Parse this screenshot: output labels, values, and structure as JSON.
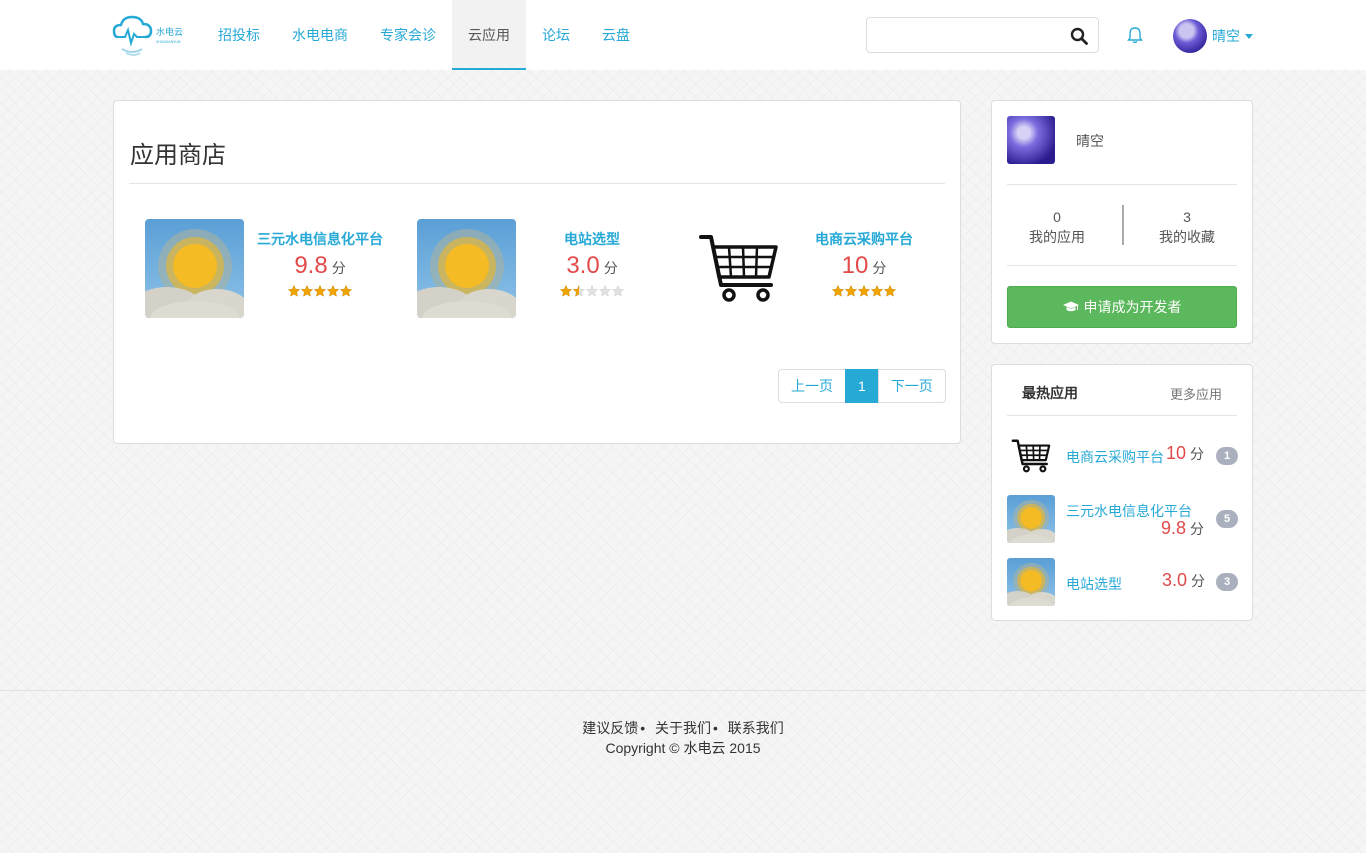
{
  "brand": {
    "name": "水电云",
    "subtitle": "SHUIDIANYUN"
  },
  "nav": {
    "items": [
      {
        "label": "招投标"
      },
      {
        "label": "水电电商"
      },
      {
        "label": "专家会诊"
      },
      {
        "label": "云应用",
        "active": true
      },
      {
        "label": "论坛"
      },
      {
        "label": "云盘"
      }
    ]
  },
  "search": {
    "placeholder": "",
    "value": ""
  },
  "user": {
    "name": "晴空"
  },
  "store": {
    "title": "应用商店",
    "apps": [
      {
        "name": "三元水电信息化平台",
        "score": "9.8",
        "unit": "分",
        "rating": 5,
        "icon": "weather-sun-cloud-icon"
      },
      {
        "name": "电站选型",
        "score": "3.0",
        "unit": "分",
        "rating": 1.5,
        "icon": "weather-sun-cloud-icon"
      },
      {
        "name": "电商云采购平台",
        "score": "10",
        "unit": "分",
        "rating": 5,
        "icon": "shopping-cart-icon"
      }
    ],
    "pagination": {
      "prev": "上一页",
      "current": "1",
      "next": "下一页"
    }
  },
  "profile": {
    "name": "晴空",
    "stats": [
      {
        "value": "0",
        "label": "我的应用"
      },
      {
        "value": "3",
        "label": "我的收藏"
      }
    ],
    "apply_button": "申请成为开发者"
  },
  "hot": {
    "title": "最热应用",
    "more": "更多应用",
    "items": [
      {
        "name": "电商云采购平台",
        "score": "10",
        "unit": "分",
        "count": "1",
        "icon": "shopping-cart-icon"
      },
      {
        "name": "三元水电信息化平台",
        "score": "9.8",
        "unit": "分",
        "count": "5",
        "icon": "weather-sun-cloud-icon"
      },
      {
        "name": "电站选型",
        "score": "3.0",
        "unit": "分",
        "count": "3",
        "icon": "weather-sun-cloud-icon"
      }
    ]
  },
  "footer": {
    "links": [
      "建议反馈",
      "关于我们",
      "联系我们"
    ],
    "separator": "•",
    "copyright": "Copyright © 水电云 2015"
  },
  "colors": {
    "accent": "#27a9d6",
    "success": "#5cb85c",
    "score": "#e24a4a",
    "star": "#f0a500"
  }
}
